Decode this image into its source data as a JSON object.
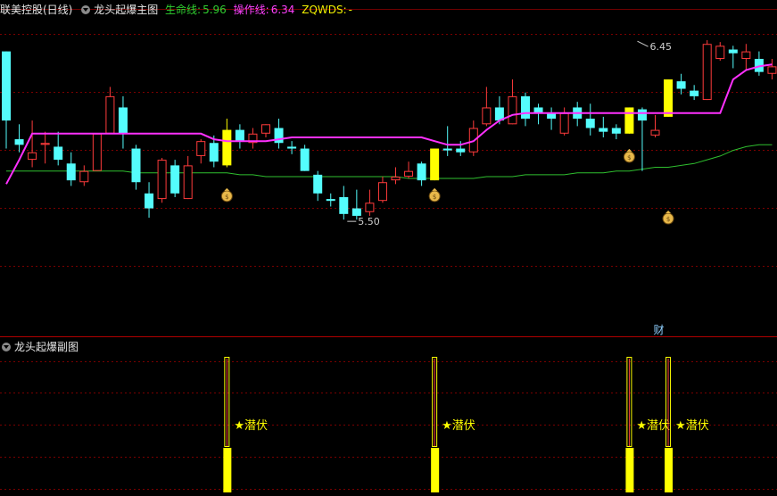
{
  "main_header": {
    "stock": "联美控股(日线)",
    "indicator": "龙头起爆主图",
    "life_line_label": "生命线:",
    "life_line_value": "5.96",
    "op_line_label": "操作线:",
    "op_line_value": "6.34",
    "zq_label": "ZQWDS:",
    "zq_value": "-"
  },
  "sub_header": {
    "indicator": "龙头起爆副图"
  },
  "colors": {
    "up": "#ff3b3b",
    "down": "#54fcfc",
    "signal": "#ffff00",
    "life_line": "#2fbf2f",
    "op_line": "#ff30ff",
    "grid": "#7a0000"
  },
  "chart_data": {
    "type": "candlestick",
    "price_range": [
      4.88,
      6.57
    ],
    "high_annotation": {
      "index": 50,
      "value": "6.45"
    },
    "low_annotation": {
      "index": 26,
      "value": "5.50"
    },
    "candles": [
      {
        "o": 6.4,
        "c": 6.03,
        "h": 6.4,
        "l": 5.88
      },
      {
        "o": 5.93,
        "c": 5.9,
        "h": 6.01,
        "l": 5.86
      },
      {
        "o": 5.82,
        "c": 5.86,
        "h": 6.03,
        "l": 5.78
      },
      {
        "o": 5.9,
        "c": 5.91,
        "h": 5.97,
        "l": 5.8
      },
      {
        "o": 5.89,
        "c": 5.82,
        "h": 5.97,
        "l": 5.79
      },
      {
        "o": 5.8,
        "c": 5.71,
        "h": 5.86,
        "l": 5.68
      },
      {
        "o": 5.7,
        "c": 5.76,
        "h": 5.79,
        "l": 5.68
      },
      {
        "o": 5.76,
        "c": 5.96,
        "h": 5.96,
        "l": 5.76
      },
      {
        "o": 5.96,
        "c": 6.16,
        "h": 6.21,
        "l": 5.96
      },
      {
        "o": 6.1,
        "c": 5.96,
        "h": 6.16,
        "l": 5.88
      },
      {
        "o": 5.88,
        "c": 5.7,
        "h": 5.9,
        "l": 5.66
      },
      {
        "o": 5.64,
        "c": 5.56,
        "h": 5.7,
        "l": 5.51
      },
      {
        "o": 5.61,
        "c": 5.82,
        "h": 5.83,
        "l": 5.59
      },
      {
        "o": 5.79,
        "c": 5.64,
        "h": 5.82,
        "l": 5.62
      },
      {
        "o": 5.61,
        "c": 5.79,
        "h": 5.84,
        "l": 5.61
      },
      {
        "o": 5.84,
        "c": 5.92,
        "h": 5.93,
        "l": 5.8
      },
      {
        "o": 5.91,
        "c": 5.81,
        "h": 5.95,
        "l": 5.78
      },
      {
        "o": 5.79,
        "c": 5.98,
        "h": 6.04,
        "l": 5.78,
        "sig": true
      },
      {
        "o": 5.98,
        "c": 5.92,
        "h": 6.01,
        "l": 5.88
      },
      {
        "o": 5.91,
        "c": 5.96,
        "h": 5.99,
        "l": 5.88
      },
      {
        "o": 5.96,
        "c": 6.01,
        "h": 6.01,
        "l": 5.94
      },
      {
        "o": 5.99,
        "c": 5.91,
        "h": 6.04,
        "l": 5.88
      },
      {
        "o": 5.89,
        "c": 5.88,
        "h": 5.92,
        "l": 5.85
      },
      {
        "o": 5.88,
        "c": 5.76,
        "h": 5.9,
        "l": 5.76
      },
      {
        "o": 5.74,
        "c": 5.64,
        "h": 5.76,
        "l": 5.6
      },
      {
        "o": 5.61,
        "c": 5.6,
        "h": 5.64,
        "l": 5.57
      },
      {
        "o": 5.62,
        "c": 5.53,
        "h": 5.68,
        "l": 5.5
      },
      {
        "o": 5.56,
        "c": 5.52,
        "h": 5.66,
        "l": 5.5
      },
      {
        "o": 5.54,
        "c": 5.59,
        "h": 5.66,
        "l": 5.52
      },
      {
        "o": 5.6,
        "c": 5.7,
        "h": 5.73,
        "l": 5.59
      },
      {
        "o": 5.71,
        "c": 5.73,
        "h": 5.78,
        "l": 5.69
      },
      {
        "o": 5.73,
        "c": 5.76,
        "h": 5.81,
        "l": 5.72
      },
      {
        "o": 5.8,
        "c": 5.71,
        "h": 5.81,
        "l": 5.68
      },
      {
        "o": 5.71,
        "c": 5.88,
        "h": 5.88,
        "l": 5.71,
        "sig": true
      },
      {
        "o": 5.88,
        "c": 5.87,
        "h": 6.0,
        "l": 5.84
      },
      {
        "o": 5.88,
        "c": 5.86,
        "h": 5.92,
        "l": 5.84
      },
      {
        "o": 5.86,
        "c": 5.99,
        "h": 6.03,
        "l": 5.84
      },
      {
        "o": 6.01,
        "c": 6.1,
        "h": 6.21,
        "l": 6.0
      },
      {
        "o": 6.1,
        "c": 6.03,
        "h": 6.16,
        "l": 6.01
      },
      {
        "o": 6.01,
        "c": 6.16,
        "h": 6.25,
        "l": 6.01
      },
      {
        "o": 6.16,
        "c": 6.04,
        "h": 6.18,
        "l": 6.0
      },
      {
        "o": 6.1,
        "c": 6.07,
        "h": 6.12,
        "l": 6.01
      },
      {
        "o": 6.07,
        "c": 6.04,
        "h": 6.1,
        "l": 5.98
      },
      {
        "o": 5.96,
        "c": 6.07,
        "h": 6.1,
        "l": 5.95
      },
      {
        "o": 6.1,
        "c": 6.04,
        "h": 6.13,
        "l": 6.0
      },
      {
        "o": 6.04,
        "c": 5.99,
        "h": 6.12,
        "l": 5.95
      },
      {
        "o": 5.99,
        "c": 5.97,
        "h": 6.05,
        "l": 5.94
      },
      {
        "o": 5.99,
        "c": 5.96,
        "h": 6.01,
        "l": 5.93
      },
      {
        "o": 5.96,
        "c": 6.1,
        "h": 6.1,
        "l": 5.96,
        "sig": true
      },
      {
        "o": 6.09,
        "c": 6.03,
        "h": 6.1,
        "l": 5.76
      },
      {
        "o": 5.95,
        "c": 5.98,
        "h": 6.06,
        "l": 5.94
      },
      {
        "o": 6.05,
        "c": 6.25,
        "h": 6.25,
        "l": 6.05,
        "sig": true
      },
      {
        "o": 6.24,
        "c": 6.2,
        "h": 6.28,
        "l": 6.17
      },
      {
        "o": 6.19,
        "c": 6.16,
        "h": 6.22,
        "l": 6.14
      },
      {
        "o": 6.14,
        "c": 6.44,
        "h": 6.46,
        "l": 6.14
      },
      {
        "o": 6.36,
        "c": 6.43,
        "h": 6.45,
        "l": 6.35
      },
      {
        "o": 6.41,
        "c": 6.39,
        "h": 6.43,
        "l": 6.31
      },
      {
        "o": 6.36,
        "c": 6.4,
        "h": 6.44,
        "l": 6.3
      },
      {
        "o": 6.36,
        "c": 6.29,
        "h": 6.4,
        "l": 6.27
      },
      {
        "o": 6.28,
        "c": 6.32,
        "h": 6.36,
        "l": 6.25
      }
    ],
    "life_line": [
      5.76,
      5.76,
      5.76,
      5.76,
      5.76,
      5.76,
      5.76,
      5.76,
      5.76,
      5.76,
      5.75,
      5.75,
      5.75,
      5.75,
      5.75,
      5.75,
      5.75,
      5.75,
      5.74,
      5.74,
      5.73,
      5.73,
      5.73,
      5.73,
      5.73,
      5.73,
      5.73,
      5.73,
      5.73,
      5.73,
      5.73,
      5.72,
      5.72,
      5.72,
      5.72,
      5.72,
      5.72,
      5.73,
      5.73,
      5.73,
      5.74,
      5.74,
      5.74,
      5.74,
      5.75,
      5.75,
      5.75,
      5.76,
      5.76,
      5.77,
      5.78,
      5.78,
      5.79,
      5.8,
      5.82,
      5.84,
      5.87,
      5.89,
      5.9,
      5.9
    ],
    "op_line": [
      5.69,
      5.82,
      5.96,
      5.96,
      5.96,
      5.96,
      5.96,
      5.96,
      5.96,
      5.96,
      5.96,
      5.96,
      5.96,
      5.96,
      5.96,
      5.96,
      5.93,
      5.92,
      5.92,
      5.92,
      5.92,
      5.93,
      5.94,
      5.94,
      5.94,
      5.94,
      5.94,
      5.94,
      5.94,
      5.94,
      5.94,
      5.94,
      5.94,
      5.92,
      5.9,
      5.9,
      5.92,
      5.98,
      6.03,
      6.06,
      6.07,
      6.07,
      6.07,
      6.07,
      6.07,
      6.07,
      6.07,
      6.07,
      6.07,
      6.07,
      6.07,
      6.07,
      6.07,
      6.07,
      6.07,
      6.07,
      6.25,
      6.3,
      6.32,
      6.33
    ],
    "money_bags": [
      {
        "index": 17,
        "value": 5.63
      },
      {
        "index": 33,
        "value": 5.63
      },
      {
        "index": 48,
        "value": 5.84
      },
      {
        "index": 51,
        "value": 5.51
      }
    ],
    "cai_label": {
      "index": 50,
      "text": "财"
    },
    "sub_signals": [
      {
        "index": 17,
        "label": "★潜伏"
      },
      {
        "index": 33,
        "label": "★潜伏"
      },
      {
        "index": 48,
        "label": "★潜伏"
      },
      {
        "index": 51,
        "label": "★潜伏"
      }
    ]
  }
}
